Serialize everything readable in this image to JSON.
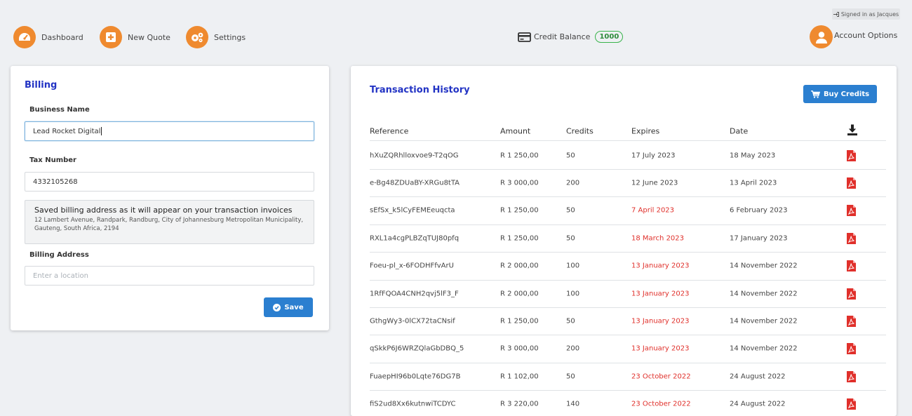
{
  "header": {
    "signed_in": "Signed in as Jacques",
    "nav": [
      {
        "label": "Dashboard",
        "icon": "dashboard-icon"
      },
      {
        "label": "New Quote",
        "icon": "plus-icon"
      },
      {
        "label": "Settings",
        "icon": "gears-icon"
      }
    ],
    "credit_label": "Credit Balance",
    "credit_value": "1000",
    "account_label": "Account Options"
  },
  "billing": {
    "title": "Billing",
    "business_name_label": "Business Name",
    "business_name_value": "Lead Rocket Digital",
    "tax_label": "Tax Number",
    "tax_value": "4332105268",
    "saved_title": "Saved billing address as it will appear on your transaction invoices",
    "saved_address": "12 Lambert Avenue, Randpark, Randburg, City of Johannesburg Metropolitan Municipality, Gauteng, South Africa, 2194",
    "address_label": "Billing Address",
    "address_placeholder": "Enter a location",
    "save_label": "Save"
  },
  "history": {
    "title": "Transaction History",
    "buy_label": "Buy Credits",
    "columns": [
      "Reference",
      "Amount",
      "Credits",
      "Expires",
      "Date"
    ],
    "rows": [
      {
        "ref": "hXuZQRhlloxvoe9-T2qOG",
        "amount": "R 1 250,00",
        "credits": "50",
        "expires": "17 July 2023",
        "date": "18 May 2023",
        "expired": false
      },
      {
        "ref": "e-Bg48ZDUaBY-XRGu8tTA",
        "amount": "R 3 000,00",
        "credits": "200",
        "expires": "12 June 2023",
        "date": "13 April 2023",
        "expired": false
      },
      {
        "ref": "sEfSx_k5lCyFEMEeuqcta",
        "amount": "R 1 250,00",
        "credits": "50",
        "expires": "7 April 2023",
        "date": "6 February 2023",
        "expired": true
      },
      {
        "ref": "RXL1a4cgPLBZqTUJ80pfq",
        "amount": "R 1 250,00",
        "credits": "50",
        "expires": "18 March 2023",
        "date": "17 January 2023",
        "expired": true
      },
      {
        "ref": "Foeu-pl_x-6FODHFfvArU",
        "amount": "R 2 000,00",
        "credits": "100",
        "expires": "13 January 2023",
        "date": "14 November 2022",
        "expired": true
      },
      {
        "ref": "1RfFQOA4CNH2qvj5lF3_F",
        "amount": "R 2 000,00",
        "credits": "100",
        "expires": "13 January 2023",
        "date": "14 November 2022",
        "expired": true
      },
      {
        "ref": "GthgWy3-0lCX72taCNsif",
        "amount": "R 1 250,00",
        "credits": "50",
        "expires": "13 January 2023",
        "date": "14 November 2022",
        "expired": true
      },
      {
        "ref": "qSkkP6J6WRZQlaGbDBQ_5",
        "amount": "R 3 000,00",
        "credits": "200",
        "expires": "13 January 2023",
        "date": "14 November 2022",
        "expired": true
      },
      {
        "ref": "FuaepHI96b0Lqte76DG7B",
        "amount": "R 1 102,00",
        "credits": "50",
        "expires": "23 October 2022",
        "date": "24 August 2022",
        "expired": true
      },
      {
        "ref": "fiS2ud8Xx6kutnwiTCDYC",
        "amount": "R 3 220,00",
        "credits": "140",
        "expires": "23 October 2022",
        "date": "24 August 2022",
        "expired": true
      }
    ]
  },
  "colors": {
    "accent_orange": "#ef8a2f",
    "primary_blue": "#2b7fd0",
    "title_blue": "#2233c4",
    "expired_red": "#e0302b",
    "badge_green": "#38b34a"
  }
}
